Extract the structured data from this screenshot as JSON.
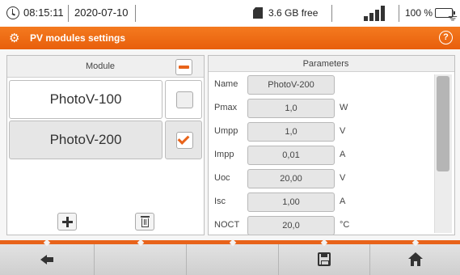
{
  "status_bar": {
    "time": "08:15:11",
    "date": "2020-07-10",
    "storage_free": "3.6 GB free",
    "battery": "100 %"
  },
  "title_bar": {
    "title": "PV modules settings",
    "help": "?"
  },
  "modules_panel": {
    "header": "Module",
    "modules": [
      {
        "name": "PhotoV-100",
        "checked": false
      },
      {
        "name": "PhotoV-200",
        "checked": true
      }
    ]
  },
  "parameters_panel": {
    "header": "Parameters",
    "name_label": "Name",
    "name_value": "PhotoV-200",
    "params": [
      {
        "label": "Pmax",
        "value": "1,0",
        "unit": "W"
      },
      {
        "label": "Umpp",
        "value": "1,0",
        "unit": "V"
      },
      {
        "label": "Impp",
        "value": "0,01",
        "unit": "A"
      },
      {
        "label": "Uoc",
        "value": "20,00",
        "unit": "V"
      },
      {
        "label": "Isc",
        "value": "1,00",
        "unit": "A"
      },
      {
        "label": "NOCT",
        "value": "20,0",
        "unit": "°C"
      }
    ]
  },
  "colors": {
    "accent": "#e8631a",
    "title_bar": "#f47a1f"
  },
  "icons": {
    "status": [
      "clock-icon",
      "sd-card-icon",
      "signal-icon",
      "battery-icon",
      "plug-icon"
    ],
    "title": [
      "gear-icon",
      "help-icon"
    ],
    "bottom_bar": [
      "back-arrow-icon",
      "save-icon",
      "home-icon"
    ]
  }
}
